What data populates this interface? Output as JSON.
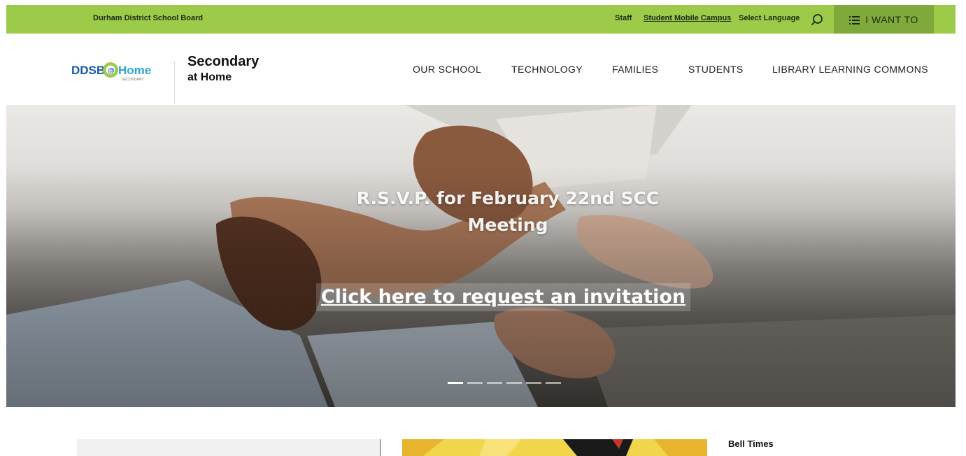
{
  "topbar": {
    "board_name": "Durham District School Board",
    "staff": "Staff",
    "student_campus": "Student Mobile Campus",
    "select_language": "Select Language",
    "search_icon": "search-icon",
    "i_want_to": "I WANT TO",
    "i_want_icon": "list-icon",
    "color": "#9ccb4a"
  },
  "header": {
    "logo_text": "DDSB@Home",
    "logo_sub": "SECONDARY",
    "title": "Secondary",
    "subtitle": "at Home"
  },
  "nav": {
    "items": [
      "OUR SCHOOL",
      "TECHNOLOGY",
      "FAMILIES",
      "STUDENTS",
      "LIBRARY LEARNING COMMONS"
    ]
  },
  "hero": {
    "title": "R.S.V.P. for February 22nd SCC Meeting",
    "link": "Click here to request an invitation",
    "slides": 6,
    "active_slide": 1
  },
  "sidebar": {
    "bell_times": "Bell Times"
  }
}
